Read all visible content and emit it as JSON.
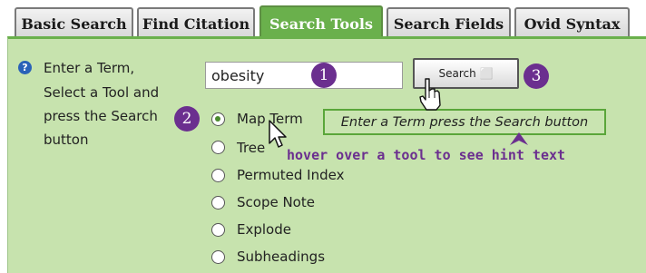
{
  "tabs": [
    {
      "label": "Basic Search"
    },
    {
      "label": "Find Citation"
    },
    {
      "label": "Search Tools"
    },
    {
      "label": "Search Fields"
    },
    {
      "label": "Ovid Syntax"
    }
  ],
  "instructions": {
    "lines": [
      "Enter a Term,",
      "Select a Tool and",
      "press the Search",
      "button"
    ]
  },
  "search": {
    "value": "obesity",
    "button_label": "Search ⬜"
  },
  "badges": [
    "1",
    "2",
    "3"
  ],
  "tools": [
    {
      "label": "Map Term",
      "selected": true
    },
    {
      "label": "Tree",
      "selected": false
    },
    {
      "label": "Permuted Index",
      "selected": false
    },
    {
      "label": "Scope Note",
      "selected": false
    },
    {
      "label": "Explode",
      "selected": false
    },
    {
      "label": "Subheadings",
      "selected": false
    }
  ],
  "hint_text": "Enter a Term press the Search button",
  "annotation": "hover over a tool to see hint text",
  "colors": {
    "accent": "#6ab04c",
    "panel": "#c7e3ae",
    "badge": "#6b2f8f",
    "help": "#2a62b8"
  }
}
